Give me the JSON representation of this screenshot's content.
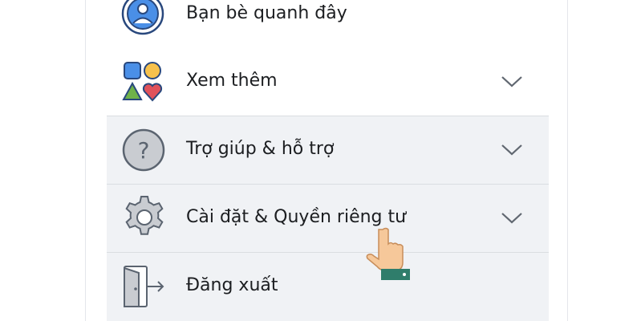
{
  "menu": {
    "items": [
      {
        "label": "Bạn bè quanh đây",
        "icon": "nearby-friends-icon",
        "expandable": false
      },
      {
        "label": "Xem thêm",
        "icon": "see-more-shapes-icon",
        "expandable": true
      },
      {
        "label": "Trợ giúp & hỗ trợ",
        "icon": "help-question-icon",
        "expandable": true
      },
      {
        "label": "Cài đặt & Quyền riêng tư",
        "icon": "settings-gear-icon",
        "expandable": true
      },
      {
        "label": "Đăng xuất",
        "icon": "logout-door-icon",
        "expandable": false
      }
    ]
  },
  "colors": {
    "highlight_bg": "#f0f2f5",
    "text": "#1c1e21",
    "chevron": "#606770"
  }
}
